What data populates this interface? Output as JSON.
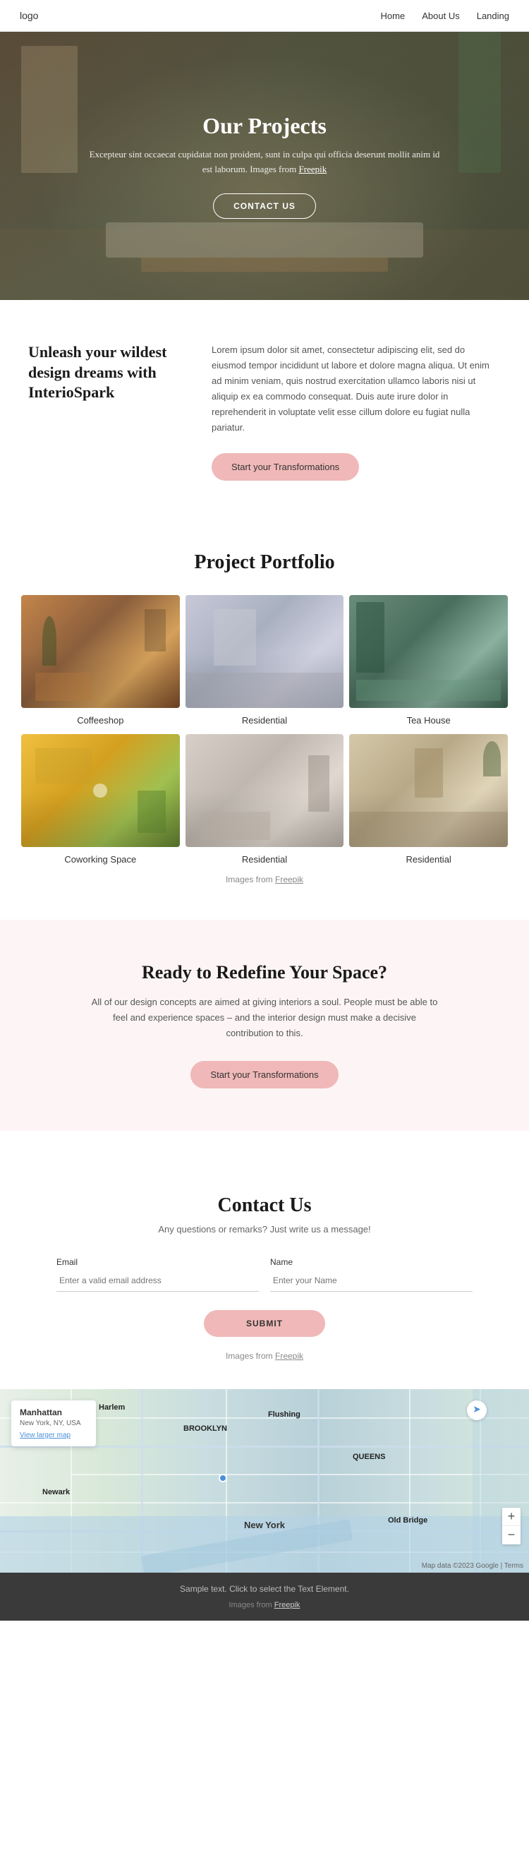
{
  "navbar": {
    "logo": "logo",
    "links": [
      {
        "label": "Home",
        "href": "#"
      },
      {
        "label": "About Us",
        "href": "#"
      },
      {
        "label": "Landing",
        "href": "#"
      }
    ]
  },
  "hero": {
    "title": "Our Projects",
    "description": "Excepteur sint occaecat cupidatat non proident, sunt in culpa qui officia deserunt mollit anim id est laborum. Images from",
    "freepik_link": "Freepik",
    "cta": "CONTACT US"
  },
  "unleash": {
    "heading": "Unleash your wildest design dreams with InterioSpark",
    "body": "Lorem ipsum dolor sit amet, consectetur adipiscing elit, sed do eiusmod tempor incididunt ut labore et dolore magna aliqua. Ut enim ad minim veniam, quis nostrud exercitation ullamco laboris nisi ut aliquip ex ea commodo consequat. Duis aute irure dolor in reprehenderit in voluptate velit esse cillum dolore eu fugiat nulla pariatur.",
    "cta": "Start your Transformations"
  },
  "portfolio": {
    "title": "Project Portfolio",
    "items": [
      {
        "label": "Coffeeshop",
        "class": "coffeeshop"
      },
      {
        "label": "Residential",
        "class": "residential1"
      },
      {
        "label": "Tea House",
        "class": "teahouse"
      },
      {
        "label": "Coworking Space",
        "class": "coworking"
      },
      {
        "label": "Residential",
        "class": "residential2"
      },
      {
        "label": "Residential",
        "class": "residential3"
      }
    ],
    "images_from": "Images from",
    "freepik_link": "Freepik"
  },
  "ready": {
    "title": "Ready to Redefine Your Space?",
    "body": "All of our design concepts are aimed at giving interiors a soul. People must be able to feel and experience spaces – and the interior design must make a decisive contribution to this.",
    "cta": "Start your Transformations"
  },
  "contact": {
    "title": "Contact Us",
    "subtitle": "Any questions or remarks? Just write us a message!",
    "email_label": "Email",
    "email_placeholder": "Enter a valid email address",
    "name_label": "Name",
    "name_placeholder": "Enter your Name",
    "submit_label": "SUBMIT",
    "images_from": "Images from",
    "freepik_link": "Freepik"
  },
  "map": {
    "place_name": "Manhattan",
    "address": "New York, NY, USA",
    "view_link": "View larger map",
    "city_label": "New York",
    "zoom_in": "+",
    "zoom_out": "−",
    "watermark": "Map data ©2023 Google | Terms"
  },
  "footer": {
    "sample_text": "Sample text. Click to select the Text Element.",
    "images_from": "Images from",
    "freepik_link": "Freepik"
  }
}
